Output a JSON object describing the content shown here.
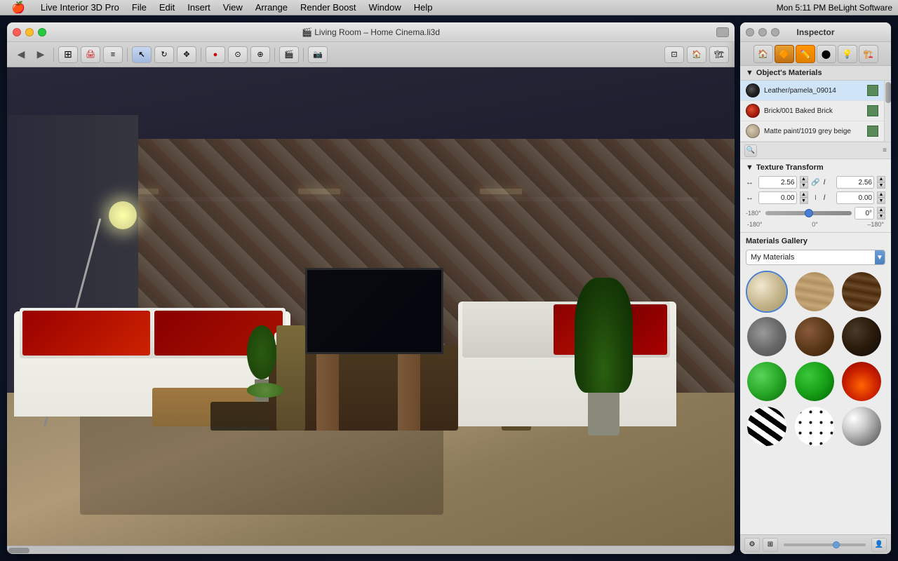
{
  "menubar": {
    "apple": "🍎",
    "items": [
      "Live Interior 3D Pro",
      "File",
      "Edit",
      "Insert",
      "View",
      "Arrange",
      "Render Boost",
      "Window",
      "Help"
    ],
    "right": "Mon 5:11 PM   BeLight Software"
  },
  "viewport": {
    "title": "🎬 Living Room – Home Cinema.li3d",
    "max_btn": "⊡"
  },
  "inspector": {
    "title": "Inspector",
    "tabs": [
      "🏠",
      "🔶",
      "✏️",
      "⬤",
      "💡",
      "🏗️"
    ],
    "active_tab_index": 2,
    "materials_section": {
      "header": "Object's Materials",
      "items": [
        {
          "name": "Leather/pamela_09014",
          "swatch_color": "#444444"
        },
        {
          "name": "Brick/001 Baked Brick",
          "swatch_color": "#cc4422"
        },
        {
          "name": "Matte paint/1019 grey beige",
          "swatch_color": "#d4c8b0"
        }
      ]
    },
    "texture_transform": {
      "header": "Texture Transform",
      "scale_x": "2.56",
      "scale_y": "2.56",
      "offset_x": "0.00",
      "offset_y": "0.00",
      "angle": "0°",
      "slider_labels": [
        "-180°",
        "0°",
        "–180°"
      ]
    },
    "gallery": {
      "header": "Materials Gallery",
      "dropdown_label": "My Materials",
      "items": [
        {
          "id": "cream",
          "class": "mat-cream"
        },
        {
          "id": "wood-light",
          "class": "mat-wood-light"
        },
        {
          "id": "wood-dark",
          "class": "mat-wood-dark"
        },
        {
          "id": "concrete",
          "class": "mat-concrete"
        },
        {
          "id": "brown",
          "class": "mat-brown-sphere"
        },
        {
          "id": "dark",
          "class": "mat-dark-sphere"
        },
        {
          "id": "green1",
          "class": "mat-green"
        },
        {
          "id": "green2",
          "class": "mat-green2"
        },
        {
          "id": "fire",
          "class": "mat-fire"
        },
        {
          "id": "zebra",
          "class": "mat-zebra"
        },
        {
          "id": "spots",
          "class": "mat-spots"
        },
        {
          "id": "chrome",
          "class": "mat-chrome"
        }
      ]
    }
  },
  "icons": {
    "arrow_back": "◀",
    "arrow_fwd": "▶",
    "select": "↖",
    "rotate": "↻",
    "move": "✥",
    "record": "●",
    "camera": "📷",
    "link": "🔗",
    "step_up": "▲",
    "step_down": "▼",
    "dropdown_arrow": "▼",
    "gear": "⚙",
    "layers": "⊞",
    "person": "👤"
  }
}
